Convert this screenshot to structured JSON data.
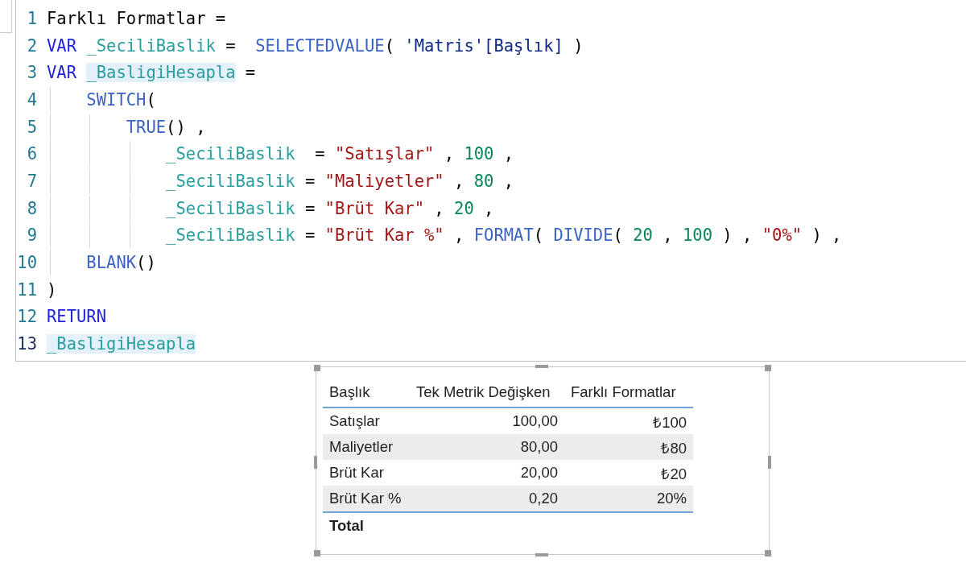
{
  "editor": {
    "lines": [
      {
        "number": "1",
        "tokens": [
          {
            "kind": "plain",
            "text": "Farklı Formatlar ="
          }
        ]
      },
      {
        "number": "2",
        "tokens": [
          {
            "kind": "keyword",
            "text": "VAR "
          },
          {
            "kind": "variable",
            "text": "_SeciliBaslik"
          },
          {
            "kind": "plain",
            "text": " =  "
          },
          {
            "kind": "function",
            "text": "SELECTEDVALUE"
          },
          {
            "kind": "plain",
            "text": "( "
          },
          {
            "kind": "column",
            "text": "'Matris'[Başlık]"
          },
          {
            "kind": "plain",
            "text": " )"
          }
        ]
      },
      {
        "number": "3",
        "tokens": [
          {
            "kind": "keyword",
            "text": "VAR "
          },
          {
            "kind": "variable",
            "text": "_BasligiHesapla",
            "highlighted": true
          },
          {
            "kind": "plain",
            "text": " ="
          }
        ]
      },
      {
        "number": "4",
        "tokens": [
          {
            "kind": "function",
            "text": "    SWITCH"
          },
          {
            "kind": "plain",
            "text": "("
          }
        ]
      },
      {
        "number": "5",
        "tokens": [
          {
            "kind": "function",
            "text": "        TRUE"
          },
          {
            "kind": "plain",
            "text": "() ,"
          }
        ]
      },
      {
        "number": "6",
        "tokens": [
          {
            "kind": "variable",
            "text": "            _SeciliBaslik"
          },
          {
            "kind": "plain",
            "text": "  = "
          },
          {
            "kind": "string",
            "text": "\"Satışlar\""
          },
          {
            "kind": "plain",
            "text": " , "
          },
          {
            "kind": "number",
            "text": "100"
          },
          {
            "kind": "plain",
            "text": " ,"
          }
        ]
      },
      {
        "number": "7",
        "tokens": [
          {
            "kind": "variable",
            "text": "            _SeciliBaslik"
          },
          {
            "kind": "plain",
            "text": " = "
          },
          {
            "kind": "string",
            "text": "\"Maliyetler\""
          },
          {
            "kind": "plain",
            "text": " , "
          },
          {
            "kind": "number",
            "text": "80"
          },
          {
            "kind": "plain",
            "text": " ,"
          }
        ]
      },
      {
        "number": "8",
        "tokens": [
          {
            "kind": "variable",
            "text": "            _SeciliBaslik"
          },
          {
            "kind": "plain",
            "text": " = "
          },
          {
            "kind": "string",
            "text": "\"Brüt Kar\""
          },
          {
            "kind": "plain",
            "text": " , "
          },
          {
            "kind": "number",
            "text": "20"
          },
          {
            "kind": "plain",
            "text": " ,"
          }
        ]
      },
      {
        "number": "9",
        "tokens": [
          {
            "kind": "variable",
            "text": "            _SeciliBaslik"
          },
          {
            "kind": "plain",
            "text": " = "
          },
          {
            "kind": "string",
            "text": "\"Brüt Kar %\""
          },
          {
            "kind": "plain",
            "text": " , "
          },
          {
            "kind": "function",
            "text": "FORMAT"
          },
          {
            "kind": "plain",
            "text": "( "
          },
          {
            "kind": "function",
            "text": "DIVIDE"
          },
          {
            "kind": "plain",
            "text": "( "
          },
          {
            "kind": "number",
            "text": "20"
          },
          {
            "kind": "plain",
            "text": " , "
          },
          {
            "kind": "number",
            "text": "100"
          },
          {
            "kind": "plain",
            "text": " ) , "
          },
          {
            "kind": "string",
            "text": "\"0%\""
          },
          {
            "kind": "plain",
            "text": " ) ,"
          }
        ]
      },
      {
        "number": "10",
        "tokens": [
          {
            "kind": "function",
            "text": "    BLANK"
          },
          {
            "kind": "plain",
            "text": "()"
          }
        ]
      },
      {
        "number": "11",
        "tokens": [
          {
            "kind": "plain",
            "text": ")"
          }
        ]
      },
      {
        "number": "12",
        "tokens": [
          {
            "kind": "keyword",
            "text": "RETURN"
          }
        ]
      },
      {
        "number": "13",
        "tokens": [
          {
            "kind": "variable",
            "text": "_BasligiHesapla",
            "highlighted": true
          }
        ]
      }
    ]
  },
  "table": {
    "columns": [
      "Başlık",
      "Tek Metrik Değişken",
      "Farklı Formatlar"
    ],
    "rows": [
      [
        "Satışlar",
        "100,00",
        "₺100"
      ],
      [
        "Maliyetler",
        "80,00",
        "₺80"
      ],
      [
        "Brüt Kar",
        "20,00",
        "₺20"
      ],
      [
        "Brüt Kar %",
        "0,20",
        "20%"
      ]
    ],
    "total": "Total"
  }
}
